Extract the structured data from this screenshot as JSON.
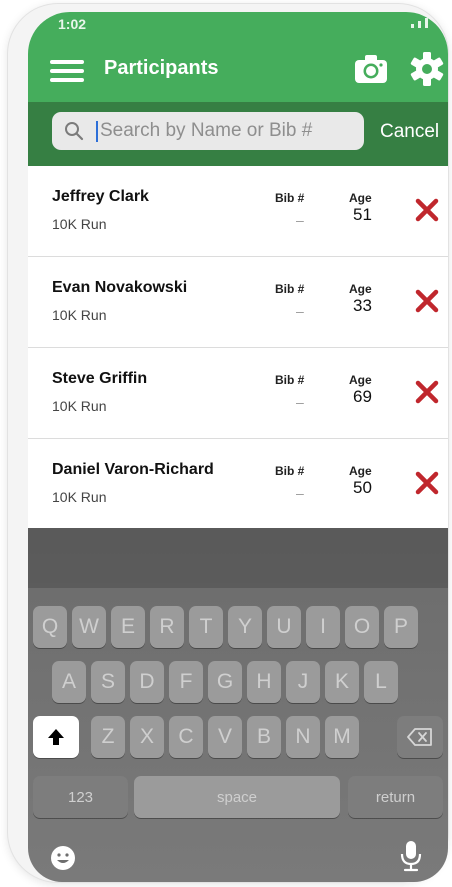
{
  "status_bar": {
    "time": "1:02"
  },
  "header": {
    "title": "Participants",
    "icons": [
      "menu-icon",
      "camera-icon",
      "gear-icon"
    ],
    "accent_color": "#45ad5c"
  },
  "search": {
    "placeholder": "Search by Name or Bib #",
    "value": "",
    "cancel_label": "Cancel",
    "bar_color": "#367f43"
  },
  "participants": [
    {
      "name": "Jeffrey Clark",
      "event": "10K Run",
      "bib_label": "Bib #",
      "bib": "–",
      "age_label": "Age",
      "age": "51"
    },
    {
      "name": "Evan Novakowski",
      "event": "10K Run",
      "bib_label": "Bib #",
      "bib": "–",
      "age_label": "Age",
      "age": "33"
    },
    {
      "name": "Steve Griffin",
      "event": "10K Run",
      "bib_label": "Bib #",
      "bib": "–",
      "age_label": "Age",
      "age": "69"
    },
    {
      "name": "Daniel Varon-Richard",
      "event": "10K Run",
      "bib_label": "Bib #",
      "bib": "–",
      "age_label": "Age",
      "age": "50"
    }
  ],
  "remove_icon_color": "#c0272d",
  "keyboard": {
    "row1": [
      "Q",
      "W",
      "E",
      "R",
      "T",
      "Y",
      "U",
      "I",
      "O",
      "P"
    ],
    "row2": [
      "A",
      "S",
      "D",
      "F",
      "G",
      "H",
      "J",
      "K",
      "L"
    ],
    "row3": [
      "Z",
      "X",
      "C",
      "V",
      "B",
      "N",
      "M"
    ],
    "numbers_label": "123",
    "space_label": "space",
    "return_label": "return"
  }
}
